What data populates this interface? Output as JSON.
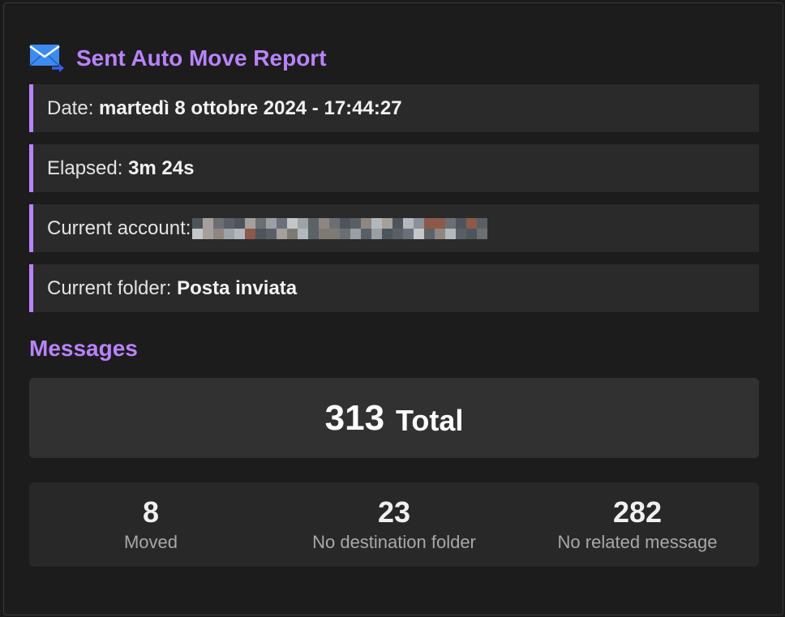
{
  "header": {
    "icon": "mail-forward-icon",
    "title": "Sent Auto Move Report"
  },
  "info": {
    "date_label": "Date:",
    "date_value": "martedì 8 ottobre 2024 - 17:44:27",
    "elapsed_label": "Elapsed:",
    "elapsed_value": "3m 24s",
    "account_label": "Current account:",
    "folder_label": "Current folder:",
    "folder_value": "Posta inviata"
  },
  "messages": {
    "section_title": "Messages",
    "total_value": "313",
    "total_label": "Total",
    "stats": [
      {
        "value": "8",
        "label": "Moved"
      },
      {
        "value": "23",
        "label": "No destination folder"
      },
      {
        "value": "282",
        "label": "No related message"
      }
    ]
  },
  "colors": {
    "accent": "#b983ff",
    "background": "#1c1c1c",
    "row_background": "#2a2a2a",
    "icon_blue": "#3b82f6"
  }
}
